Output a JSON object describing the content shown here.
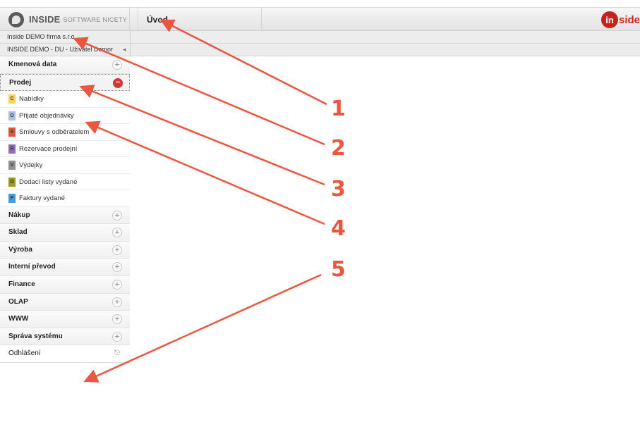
{
  "header": {
    "logo_strong": "INSIDE",
    "logo_sub": "SOFTWARE NICETY",
    "tab_label": "Úvod",
    "brand_mark": "in",
    "brand_text": "side"
  },
  "company": "Inside DEMO firma s.r.o.",
  "user": "INSIDE DEMO - DU - Uživatel Demor",
  "sidebar": {
    "items": [
      {
        "label": "Kmenová data"
      },
      {
        "label": "Prodej"
      }
    ],
    "sub_items": [
      {
        "label": "Nabídky",
        "badge": "C",
        "color": "#f4d35e"
      },
      {
        "label": "Přijaté objednávky",
        "badge": "O",
        "color": "#a9c1dd"
      },
      {
        "label": "Smlouvy s odběratelem",
        "badge": "S",
        "color": "#d95a3a"
      },
      {
        "label": "Rezervace prodejní",
        "badge": "R",
        "color": "#8b6fb8"
      },
      {
        "label": "Výdejky",
        "badge": "V",
        "color": "#8f8f8f"
      },
      {
        "label": "Dodací listy vydané",
        "badge": "D",
        "color": "#9a9a1f"
      },
      {
        "label": "Faktury vydané",
        "badge": "F",
        "color": "#4a9ad6"
      }
    ],
    "more_items": [
      {
        "label": "Nákup"
      },
      {
        "label": "Sklad"
      },
      {
        "label": "Výroba"
      },
      {
        "label": "Interní převod"
      },
      {
        "label": "Finance"
      },
      {
        "label": "OLAP"
      },
      {
        "label": "WWW"
      },
      {
        "label": "Správa systému"
      }
    ],
    "logout": "Odhlášení",
    "plus_symbol": "+",
    "minus_symbol": "−"
  },
  "annotations": [
    "1",
    "2",
    "3",
    "4",
    "5"
  ],
  "colors": {
    "annotation": "#e8573f",
    "accent_red": "#cc3b35",
    "brand_red": "#c5231c"
  }
}
